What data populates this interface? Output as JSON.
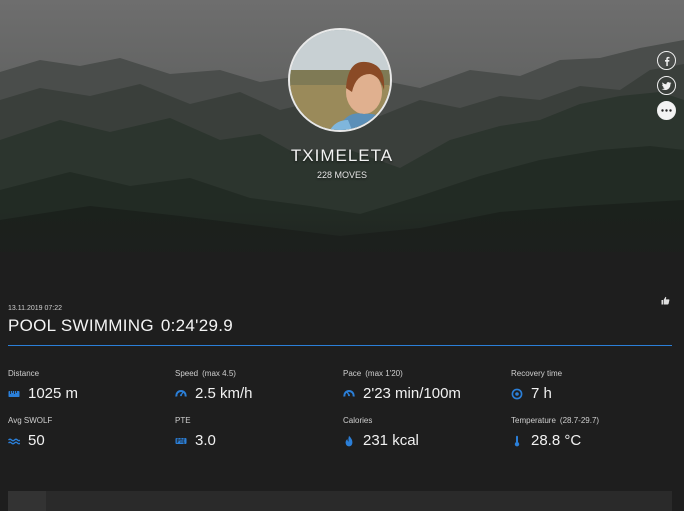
{
  "profile": {
    "username": "TXIMELETA",
    "moves": "228 MOVES"
  },
  "social": {
    "icons": [
      "facebook-icon",
      "twitter-icon",
      "more-icon"
    ]
  },
  "activity": {
    "date": "13.11.2019 07:22",
    "sport": "POOL SWIMMING",
    "duration": "0:24'29.9"
  },
  "stats": {
    "distance": {
      "label": "Distance",
      "value": "1025 m"
    },
    "speed": {
      "label": "Speed",
      "sub": "(max  4.5)",
      "value": "2.5 km/h"
    },
    "pace": {
      "label": "Pace",
      "sub": "(max  1'20)",
      "value": "2'23 min/100m"
    },
    "recovery": {
      "label": "Recovery time",
      "value": "7 h"
    },
    "swolf": {
      "label": "Avg SWOLF",
      "value": "50"
    },
    "pte": {
      "label": "PTE",
      "value": "3.0"
    },
    "calories": {
      "label": "Calories",
      "value": "231 kcal"
    },
    "temperature": {
      "label": "Temperature",
      "sub": "(28.7-29.7)",
      "value": "28.8 °C"
    }
  },
  "colors": {
    "accent": "#2b7fd8",
    "background": "#1e1e1e"
  }
}
